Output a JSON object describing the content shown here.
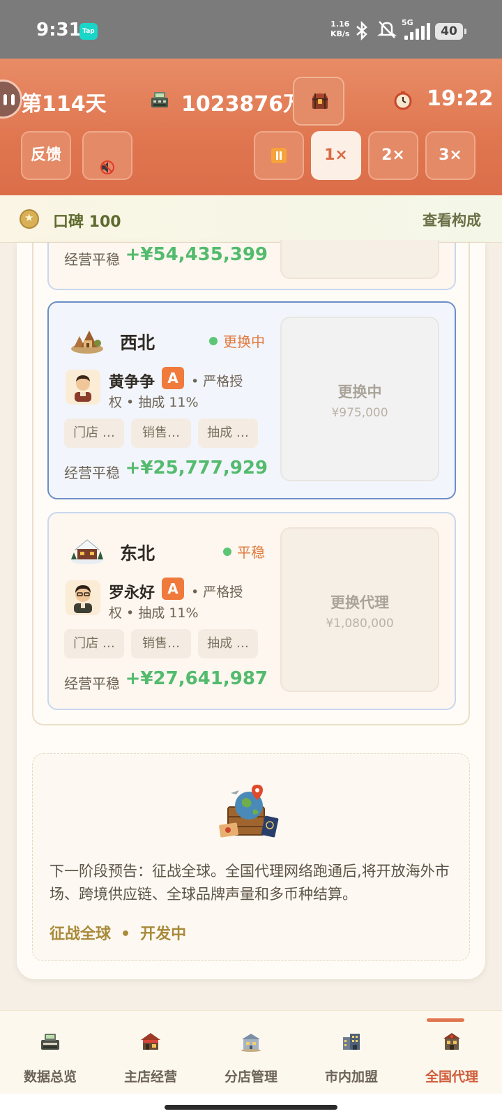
{
  "status_bar": {
    "time": "9:31",
    "app_badge": "Tap",
    "net_speed_value": "1.16",
    "net_speed_unit": "KB/s",
    "network": "5G",
    "battery": "40"
  },
  "header": {
    "day": "第114天",
    "money": "1023876万",
    "clock": "19:22",
    "feedback_label": "反馈",
    "speed_buttons": [
      "1×",
      "2×",
      "3×"
    ],
    "active_speed": "1×"
  },
  "reputation": {
    "label": "口碑 100",
    "link": "查看构成"
  },
  "agents": {
    "previous_card": {
      "perf_label": "经营平稳",
      "perf_value": "+¥54,435,399"
    },
    "cards": [
      {
        "region": "西北",
        "status": "更换中",
        "name": "黄争争",
        "grade": "A",
        "desc_line1": "• 严格授",
        "desc_line2": "权 • 抽成 11%",
        "chips": [
          "门店 …",
          "销售…",
          "抽成 …"
        ],
        "perf_label": "经营平稳",
        "perf_value": "+¥25,777,929",
        "action_title": "更换中",
        "action_price": "¥975,000"
      },
      {
        "region": "东北",
        "status": "平稳",
        "name": "罗永好",
        "grade": "A",
        "desc_line1": "• 严格授",
        "desc_line2": "权 • 抽成 11%",
        "chips": [
          "门店 …",
          "销售…",
          "抽成 …"
        ],
        "perf_label": "经营平稳",
        "perf_value": "+¥27,641,987",
        "action_title": "更换代理",
        "action_price": "¥1,080,000"
      }
    ]
  },
  "preview": {
    "text": "下一阶段预告：征战全球。全国代理网络跑通后,将开放海外市场、跨境供应链、全球品牌声量和多币种结算。",
    "status_a": "征战全球",
    "status_sep": "•",
    "status_b": "开发中"
  },
  "bottom_nav": {
    "items": [
      {
        "label": "数据总览",
        "icon": "cash-register-icon"
      },
      {
        "label": "主店经营",
        "icon": "main-shop-icon"
      },
      {
        "label": "分店管理",
        "icon": "branch-shop-icon"
      },
      {
        "label": "市内加盟",
        "icon": "city-franchise-icon"
      },
      {
        "label": "全国代理",
        "icon": "national-agent-icon"
      }
    ],
    "active": "全国代理"
  },
  "colors": {
    "header_orange": "#df7650",
    "positive_green": "#53bb6d",
    "status_orange": "#e07a3f",
    "grade_orange": "#ef7a3c",
    "active_nav": "#cf5c39",
    "selected_border": "#6b8ec7"
  }
}
